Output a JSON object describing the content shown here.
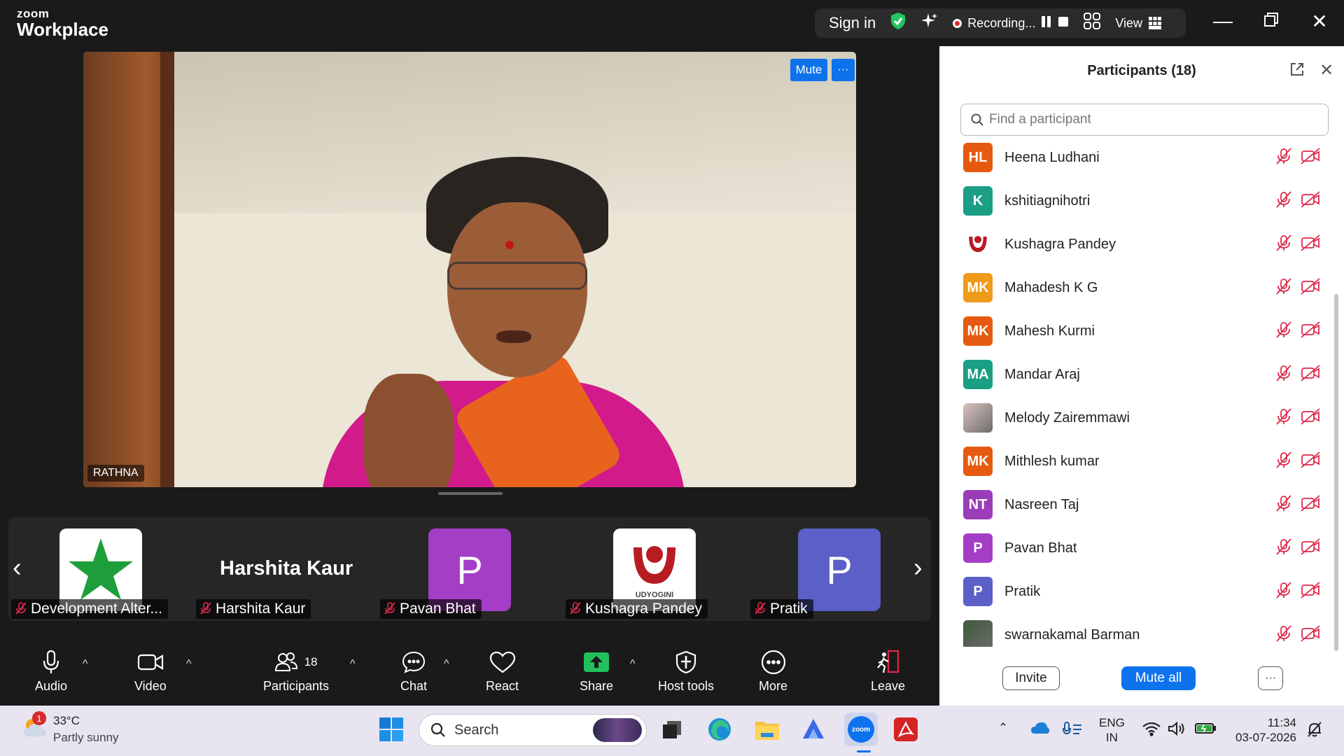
{
  "app": {
    "brand_top": "zoom",
    "brand_bottom": "Workplace"
  },
  "topbar": {
    "sign_in": "Sign in",
    "recording": "Recording...",
    "view": "View"
  },
  "main_video": {
    "name": "RATHNA",
    "mute": "Mute",
    "more": "···"
  },
  "filmstrip": {
    "tiles": [
      {
        "name": "Development Alter...",
        "kind": "logo-star"
      },
      {
        "name": "Harshita Kaur",
        "kind": "name-only",
        "display": "Harshita Kaur"
      },
      {
        "name": "Pavan Bhat",
        "kind": "letter",
        "letter": "P",
        "color": "#a43ec7"
      },
      {
        "name": "Kushagra Pandey",
        "kind": "logo-udyogini",
        "logo_text": "UDYOGINI"
      },
      {
        "name": "Pratik",
        "kind": "letter",
        "letter": "P",
        "color": "#5b5fc7"
      }
    ]
  },
  "toolbar": {
    "audio": "Audio",
    "video": "Video",
    "participants": "Participants",
    "participants_count": "18",
    "chat": "Chat",
    "react": "React",
    "share": "Share",
    "host_tools": "Host tools",
    "more": "More",
    "leave": "Leave"
  },
  "panel": {
    "title": "Participants (18)",
    "search_placeholder": "Find a participant",
    "invite": "Invite",
    "mute_all": "Mute all",
    "more": "···",
    "participants": [
      {
        "initials": "HL",
        "name": "Heena Ludhani",
        "color": "#e55a0f"
      },
      {
        "initials": "K",
        "name": "kshitiagnihotri",
        "color": "#1a9e84"
      },
      {
        "initials": "",
        "name": "Kushagra Pandey",
        "color": "#ffffff",
        "logo": true
      },
      {
        "initials": "MK",
        "name": "Mahadesh K G",
        "color": "#f09a1a"
      },
      {
        "initials": "MK",
        "name": "Mahesh Kurmi",
        "color": "#e55a0f"
      },
      {
        "initials": "MA",
        "name": "Mandar Araj",
        "color": "#1a9e84"
      },
      {
        "initials": "",
        "name": "Melody Zairemmawi",
        "color": "#d9c3bf",
        "photo": true
      },
      {
        "initials": "MK",
        "name": "Mithlesh kumar",
        "color": "#e55a0f"
      },
      {
        "initials": "NT",
        "name": "Nasreen Taj",
        "color": "#9b3db8"
      },
      {
        "initials": "P",
        "name": "Pavan Bhat",
        "color": "#a43ec7"
      },
      {
        "initials": "P",
        "name": "Pratik",
        "color": "#5b5fc7"
      },
      {
        "initials": "",
        "name": "swarnakamal Barman",
        "color": "#3e5a3a",
        "photo": true
      }
    ]
  },
  "taskbar": {
    "weather_badge": "1",
    "temperature": "33°C",
    "weather": "Partly sunny",
    "search": "Search",
    "lang_top": "ENG",
    "lang_bottom": "IN",
    "time": "11:34",
    "date": "03-07-2026"
  },
  "colors": {
    "accent": "#0e72ed",
    "mute_red": "#e0284a",
    "panel_bg": "#ffffff",
    "dark_bg": "#1a1a1a"
  }
}
